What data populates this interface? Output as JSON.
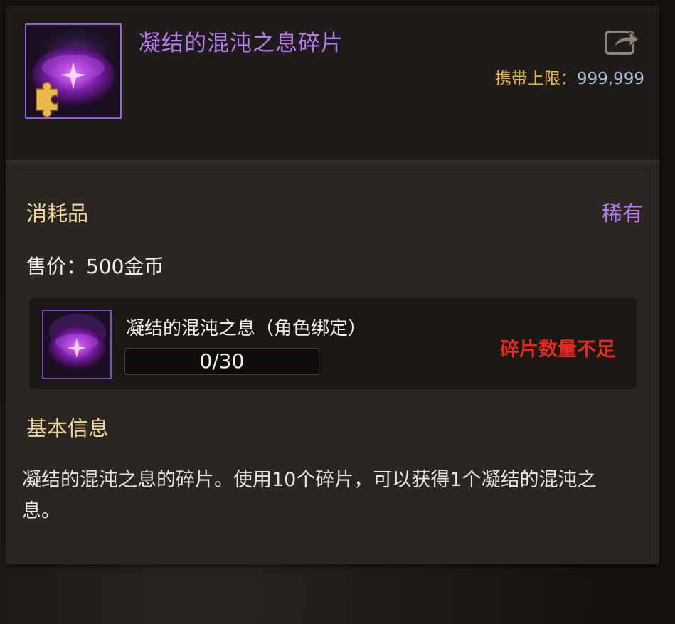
{
  "item": {
    "name": "凝结的混沌之息碎片",
    "icon": "purple-chaos-orb-fragment-icon",
    "carry_limit_label": "携带上限：",
    "carry_limit_value": "999,999",
    "category": "消耗品",
    "rarity": "稀有",
    "sell_price": "售价：500金币"
  },
  "combine": {
    "target_name": "凝结的混沌之息（角色绑定）",
    "target_icon": "purple-chaos-orb-icon",
    "progress_text": "0/30",
    "progress_fraction": 0,
    "status": "碎片数量不足"
  },
  "info": {
    "title": "基本信息",
    "description": "凝结的混沌之息的碎片。使用10个碎片，可以获得1个凝结的混沌之息。"
  },
  "colors": {
    "title_purple": "#b57af0",
    "gold_label": "#e8b84a",
    "warning_red": "#e42a1e"
  }
}
